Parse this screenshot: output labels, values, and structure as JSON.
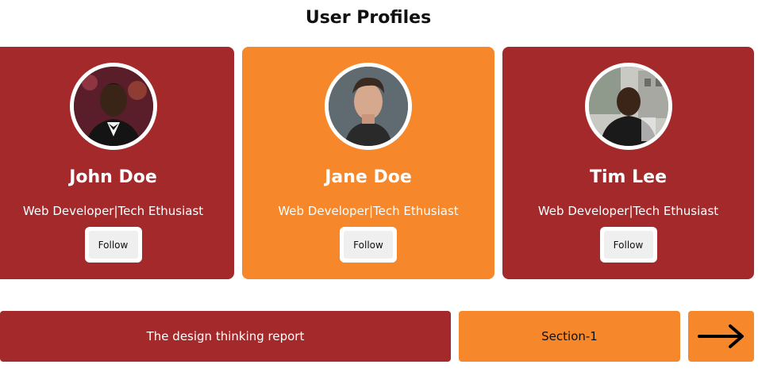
{
  "header": {
    "title": "User Profiles"
  },
  "cards": [
    {
      "name": "John Doe",
      "role": "Web Developer|Tech Ethusiast",
      "follow_label": "Follow",
      "background": "#a4292b"
    },
    {
      "name": "Jane Doe",
      "role": "Web Developer|Tech Ethusiast",
      "follow_label": "Follow",
      "background": "#f6872a"
    },
    {
      "name": "Tim Lee",
      "role": "Web Developer|Tech Ethusiast",
      "follow_label": "Follow",
      "background": "#a4292b"
    }
  ],
  "footer": {
    "report_label": "The design thinking report",
    "section_label": "Section-1",
    "next_icon": "arrow-right-icon"
  },
  "colors": {
    "red": "#a4292b",
    "orange": "#f6872a",
    "white": "#ffffff"
  }
}
